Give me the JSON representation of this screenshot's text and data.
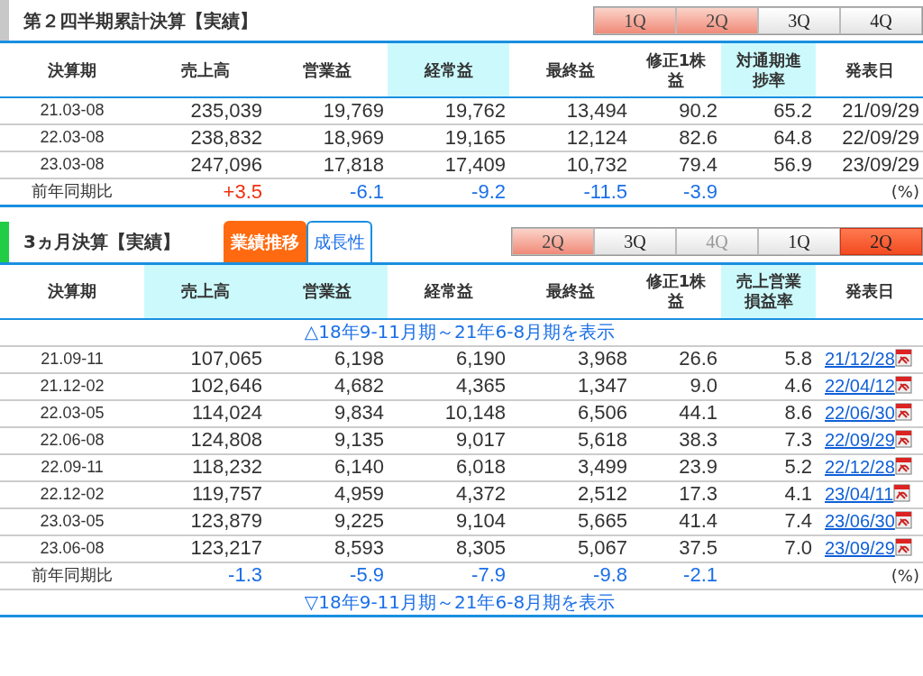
{
  "cumulative": {
    "title": "第２四半期累計決算【実績】",
    "quarters": [
      {
        "label": "1Q",
        "kind": "pink"
      },
      {
        "label": "2Q",
        "kind": "pink"
      },
      {
        "label": "3Q",
        "kind": "plain"
      },
      {
        "label": "4Q",
        "kind": "plain"
      }
    ],
    "columns": [
      {
        "label": "決算期",
        "highlighted": false
      },
      {
        "label": "売上高",
        "highlighted": false
      },
      {
        "label": "営業益",
        "highlighted": false
      },
      {
        "label": "経常益",
        "highlighted": true
      },
      {
        "label": "最終益",
        "highlighted": false
      },
      {
        "label": "修正1株益",
        "highlighted": false
      },
      {
        "label": "対通期進捗率",
        "highlighted": true
      },
      {
        "label": "発表日",
        "highlighted": false
      }
    ],
    "rows": [
      {
        "cells": [
          "21.03-08",
          "235,039",
          "19,769",
          "19,762",
          "13,494",
          "90.2",
          "65.2",
          "21/09/29"
        ]
      },
      {
        "cells": [
          "22.03-08",
          "238,832",
          "18,969",
          "19,165",
          "12,124",
          "82.6",
          "64.8",
          "22/09/29"
        ]
      },
      {
        "cells": [
          "23.03-08",
          "247,096",
          "17,818",
          "17,409",
          "10,732",
          "79.4",
          "56.9",
          "23/09/29"
        ]
      }
    ],
    "yoy": {
      "cells": [
        {
          "text": "前年同期比"
        },
        {
          "text": "+3.5",
          "color": "#f03010"
        },
        {
          "text": "-6.1",
          "color": "#1a6fe8"
        },
        {
          "text": "-9.2",
          "color": "#1a6fe8"
        },
        {
          "text": "-11.5",
          "color": "#1a6fe8"
        },
        {
          "text": "-3.9",
          "color": "#1a6fe8"
        },
        {
          "text": ""
        },
        {
          "text": "(%)"
        }
      ]
    }
  },
  "quarterly": {
    "title": "3ヵ月決算【実績】",
    "tabs": [
      {
        "label": "業績推移",
        "selected": true
      },
      {
        "label": "成長性",
        "selected": false
      }
    ],
    "quarters": [
      {
        "label": "2Q",
        "kind": "pink"
      },
      {
        "label": "3Q",
        "kind": "plain"
      },
      {
        "label": "4Q",
        "kind": "faded"
      },
      {
        "label": "1Q",
        "kind": "plain"
      },
      {
        "label": "2Q",
        "kind": "current"
      }
    ],
    "columns": [
      {
        "label": "決算期",
        "highlighted": false
      },
      {
        "label": "売上高",
        "highlighted": true
      },
      {
        "label": "営業益",
        "highlighted": true
      },
      {
        "label": "経常益",
        "highlighted": false
      },
      {
        "label": "最終益",
        "highlighted": false
      },
      {
        "label": "修正1株益",
        "highlighted": false
      },
      {
        "label": "売上営業損益率",
        "highlighted": true
      },
      {
        "label": "発表日",
        "highlighted": false
      }
    ],
    "show_earlier": "△18年9-11月期～21年6-8月期を表示",
    "rows": [
      {
        "cells": [
          "21.09-11",
          "107,065",
          "6,198",
          "6,190",
          "3,968",
          "26.6",
          "5.8",
          "21/12/28"
        ]
      },
      {
        "cells": [
          "21.12-02",
          "102,646",
          "4,682",
          "4,365",
          "1,347",
          "9.0",
          "4.6",
          "22/04/12"
        ]
      },
      {
        "cells": [
          "22.03-05",
          "114,024",
          "9,834",
          "10,148",
          "6,506",
          "44.1",
          "8.6",
          "22/06/30"
        ]
      },
      {
        "cells": [
          "22.06-08",
          "124,808",
          "9,135",
          "9,017",
          "5,618",
          "38.3",
          "7.3",
          "22/09/29"
        ]
      },
      {
        "cells": [
          "22.09-11",
          "118,232",
          "6,140",
          "6,018",
          "3,499",
          "23.9",
          "5.2",
          "22/12/28"
        ]
      },
      {
        "cells": [
          "22.12-02",
          "119,757",
          "4,959",
          "4,372",
          "2,512",
          "17.3",
          "4.1",
          "23/04/11"
        ]
      },
      {
        "cells": [
          "23.03-05",
          "123,879",
          "9,225",
          "9,104",
          "5,665",
          "41.4",
          "7.4",
          "23/06/30"
        ]
      },
      {
        "cells": [
          "23.06-08",
          "123,217",
          "8,593",
          "8,305",
          "5,067",
          "37.5",
          "7.0",
          "23/09/29"
        ]
      }
    ],
    "yoy": {
      "cells": [
        {
          "text": "前年同期比"
        },
        {
          "text": "-1.3",
          "color": "#1a6fe8"
        },
        {
          "text": "-5.9",
          "color": "#1a6fe8"
        },
        {
          "text": "-7.9",
          "color": "#1a6fe8"
        },
        {
          "text": "-9.8",
          "color": "#1a6fe8"
        },
        {
          "text": "-2.1",
          "color": "#1a6fe8"
        },
        {
          "text": ""
        },
        {
          "text": "(%)"
        }
      ]
    },
    "show_later": "▽18年9-11月期～21年6-8月期を表示"
  }
}
